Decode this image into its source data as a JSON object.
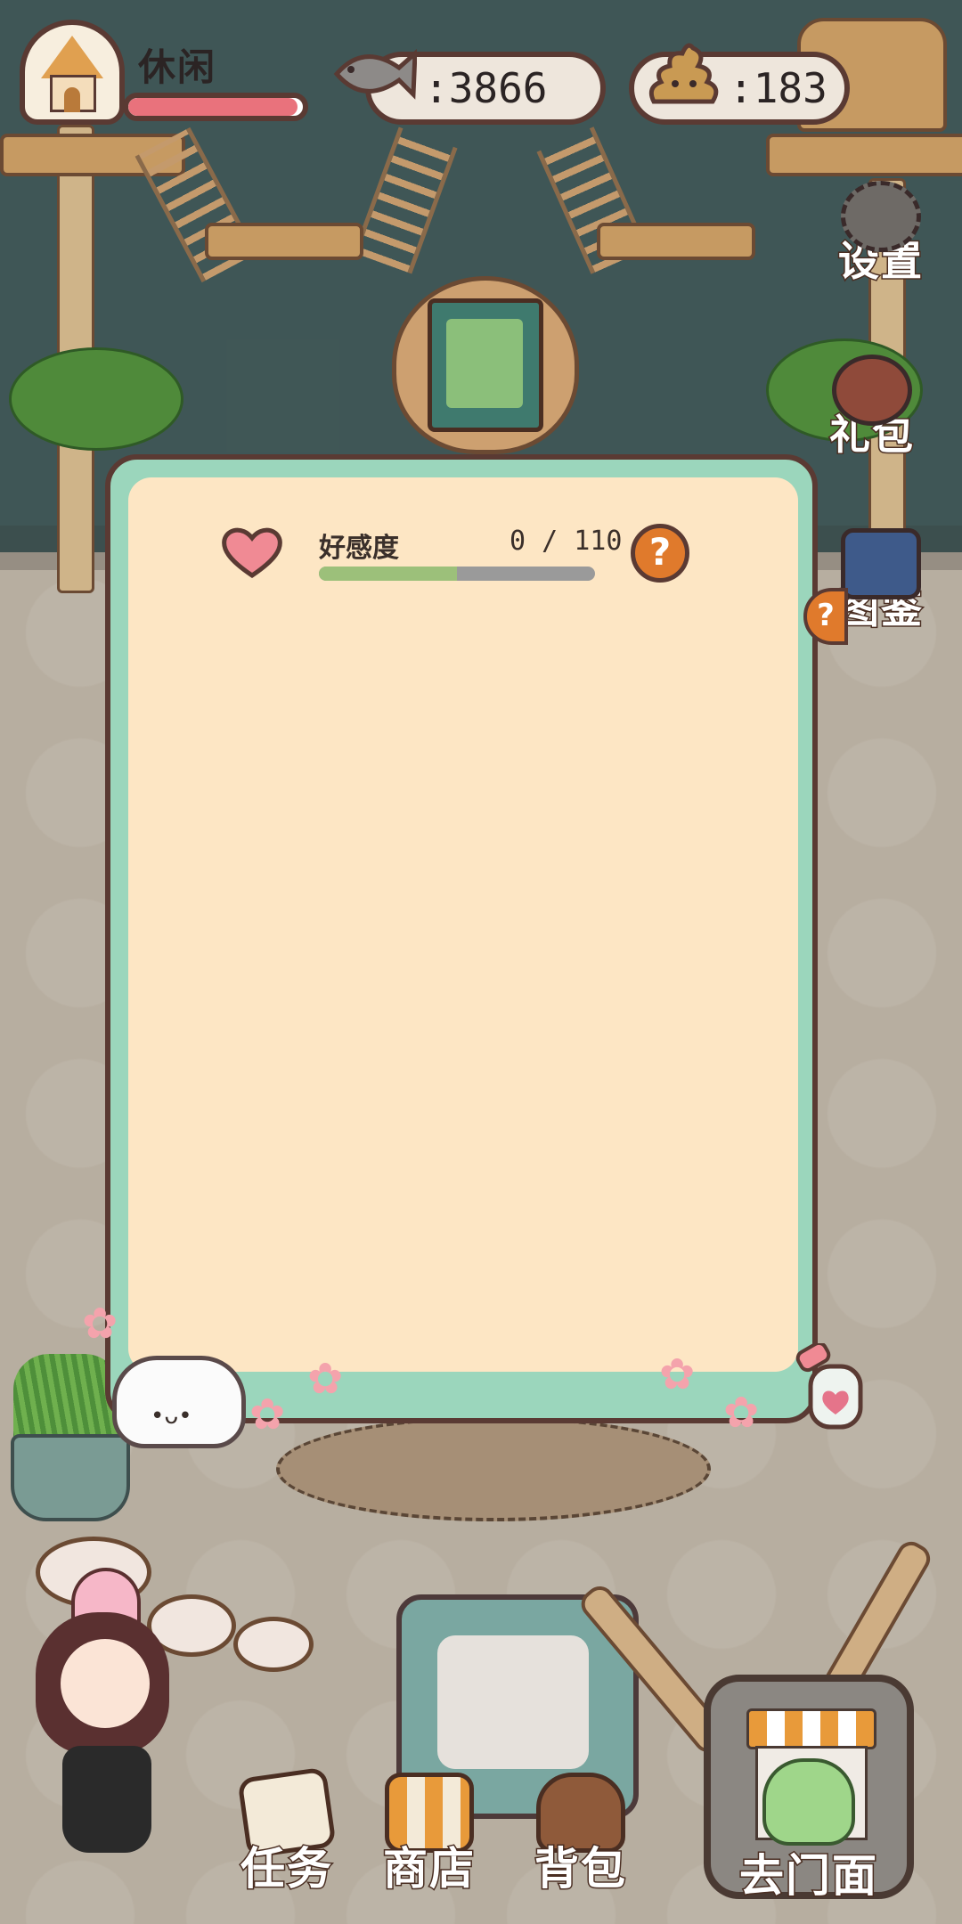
{
  "hud": {
    "status_label": "休闲",
    "mood_level": 0.97,
    "fish_count": ":3866",
    "poop_count": ":183"
  },
  "side_menu": {
    "settings": "设置",
    "gift": "礼包",
    "catalog": "图鉴"
  },
  "panel": {
    "affection_label": "好感度",
    "affection_value": "0 / 110",
    "affection_progress": 0.5,
    "help_symbol": "?"
  },
  "bottom_nav": {
    "tasks": "任务",
    "shop": "商店",
    "backpack": "背包",
    "storefront": "去门面"
  },
  "colors": {
    "mood_bar": "#e9727c",
    "panel_border": "#9bd6bc",
    "panel_fill": "#fde6c4",
    "help_button": "#e07a2c",
    "affection_fill": "#9cc07a"
  }
}
